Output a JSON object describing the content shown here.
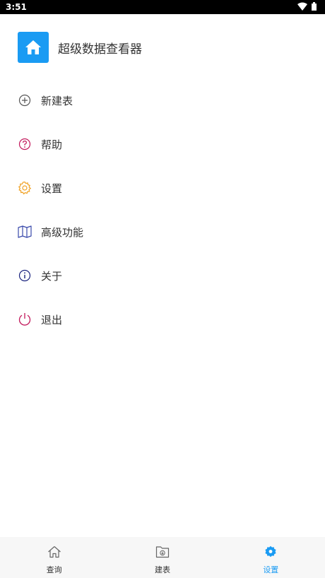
{
  "status_bar": {
    "time": "3:51"
  },
  "app": {
    "title": "超级数据查看器",
    "icon": "home-icon",
    "accent": "#1a9bf3"
  },
  "menu": {
    "items": [
      {
        "label": "新建表",
        "icon": "plus-circle-icon",
        "color": "#555555"
      },
      {
        "label": "帮助",
        "icon": "question-circle-icon",
        "color": "#c2185b"
      },
      {
        "label": "设置",
        "icon": "gear-icon",
        "color": "#f0a020"
      },
      {
        "label": "高级功能",
        "icon": "map-icon",
        "color": "#3949ab"
      },
      {
        "label": "关于",
        "icon": "info-circle-icon",
        "color": "#1a237e"
      },
      {
        "label": "退出",
        "icon": "power-icon",
        "color": "#c2185b"
      }
    ]
  },
  "tabbar": {
    "tabs": [
      {
        "label": "查询",
        "icon": "home-outline-icon",
        "active": false
      },
      {
        "label": "建表",
        "icon": "folder-download-icon",
        "active": false
      },
      {
        "label": "设置",
        "icon": "gear-filled-icon",
        "active": true
      }
    ]
  }
}
